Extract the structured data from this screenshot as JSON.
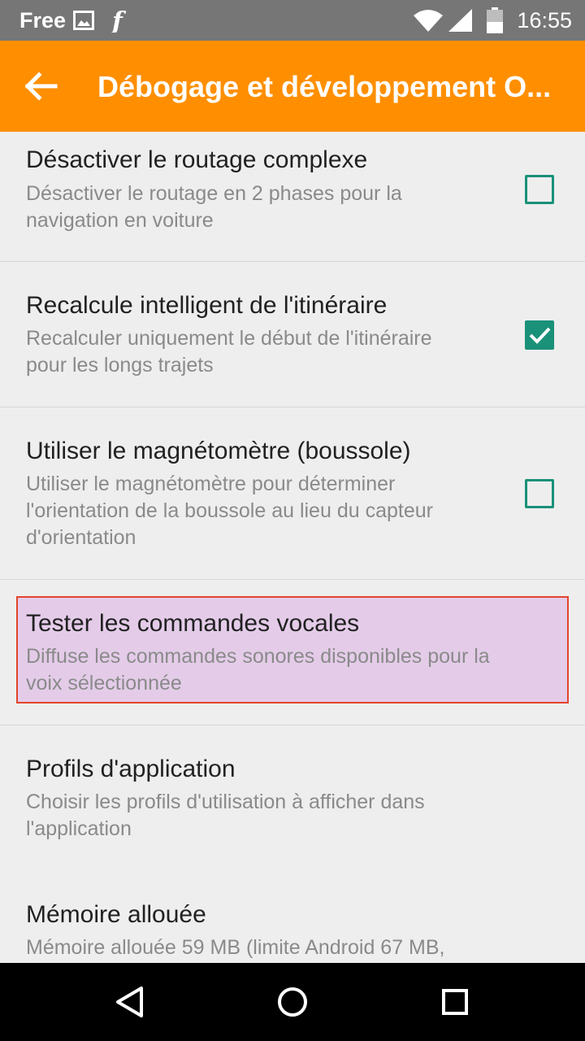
{
  "status_bar": {
    "carrier": "Free",
    "time": "16:55"
  },
  "toolbar": {
    "title": "Débogage et développement O..."
  },
  "items": [
    {
      "title": "Désactiver le routage complexe",
      "subtitle_lines": [
        "Désactiver le routage en 2 phases pour la",
        "navigation en voiture"
      ],
      "checked": false
    },
    {
      "title": "Recalcule intelligent de l'itinéraire",
      "subtitle_lines": [
        "Recalculer uniquement le début de l'itinéraire",
        "pour les longs trajets"
      ],
      "checked": true
    },
    {
      "title": "Utiliser le magnétomètre (boussole)",
      "subtitle_lines": [
        "Utiliser le magnétomètre pour déterminer",
        "l'orientation de la boussole au lieu du capteur",
        "d'orientation"
      ],
      "checked": false
    },
    {
      "title": "Tester les commandes vocales",
      "subtitle_lines": [
        "Diffuse les commandes sonores disponibles pour la",
        "voix sélectionnée"
      ],
      "highlighted": true
    },
    {
      "title": "Profils d'application",
      "subtitle_lines": [
        "Choisir les profils d'utilisation à afficher dans",
        "l'application"
      ]
    },
    {
      "title": "Mémoire allouée",
      "subtitle_lines": [
        "Mémoire allouée 59 MB (limite Android 67 MB,"
      ]
    }
  ],
  "colors": {
    "status_bar": "#767676",
    "toolbar": "#ff8f00",
    "checkbox": "#1a9179",
    "highlight_fill": "#e4cce9",
    "highlight_border": "#e5432d",
    "background": "#eeeeee"
  },
  "icons": {
    "status_left": [
      "image-icon",
      "flipboard-icon"
    ],
    "status_right": [
      "wifi-icon",
      "signal-icon",
      "battery-icon"
    ],
    "toolbar": "back-arrow-icon",
    "nav": [
      "nav-back-icon",
      "nav-home-icon",
      "nav-recents-icon"
    ]
  }
}
